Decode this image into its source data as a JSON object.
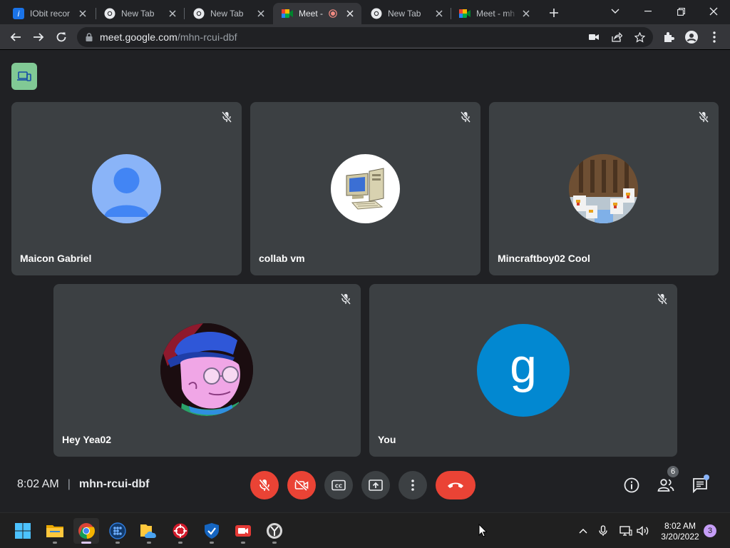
{
  "browser": {
    "tabs": [
      {
        "title": "IObit recor",
        "icon": "iobit-icon"
      },
      {
        "title": "New Tab",
        "icon": "chrome-icon"
      },
      {
        "title": "New Tab",
        "icon": "chrome-icon"
      },
      {
        "title": "Meet -",
        "icon": "meet-icon",
        "active": true,
        "recording": true
      },
      {
        "title": "New Tab",
        "icon": "chrome-icon"
      },
      {
        "title": "Meet - mh",
        "icon": "meet-icon"
      }
    ],
    "url_host": "meet.google.com",
    "url_path": "/mhn-rcui-dbf"
  },
  "meet": {
    "participants": [
      {
        "name": "Maicon Gabriel",
        "avatar": "default-person-avatar"
      },
      {
        "name": "collab vm",
        "avatar": "computer-avatar"
      },
      {
        "name": "Mincraftboy02 Cool",
        "avatar": "minecraft-chickens-avatar"
      },
      {
        "name": "Hey Yea02",
        "avatar": "cartoon-character-avatar"
      },
      {
        "name": "You",
        "avatar": "letter-avatar",
        "initial": "g",
        "color": "#0288d1"
      }
    ],
    "time": "8:02 AM",
    "separator": "|",
    "meeting_code": "mhn-rcui-dbf",
    "participant_count": "6"
  },
  "taskbar": {
    "apps": [
      "windows-start-icon",
      "file-explorer-icon",
      "chrome-icon",
      "app-dots-icon",
      "onedrive-folder-icon",
      "iobit-red-icon",
      "shield-check-icon",
      "screen-recorder-icon",
      "clock-app-icon"
    ],
    "time": "8:02 AM",
    "date": "3/20/2022",
    "notifications": "3"
  },
  "colors": {
    "accent_green": "#81c995",
    "danger_red": "#ea4335",
    "tile_bg": "#3c4043",
    "page_bg": "#202124"
  }
}
